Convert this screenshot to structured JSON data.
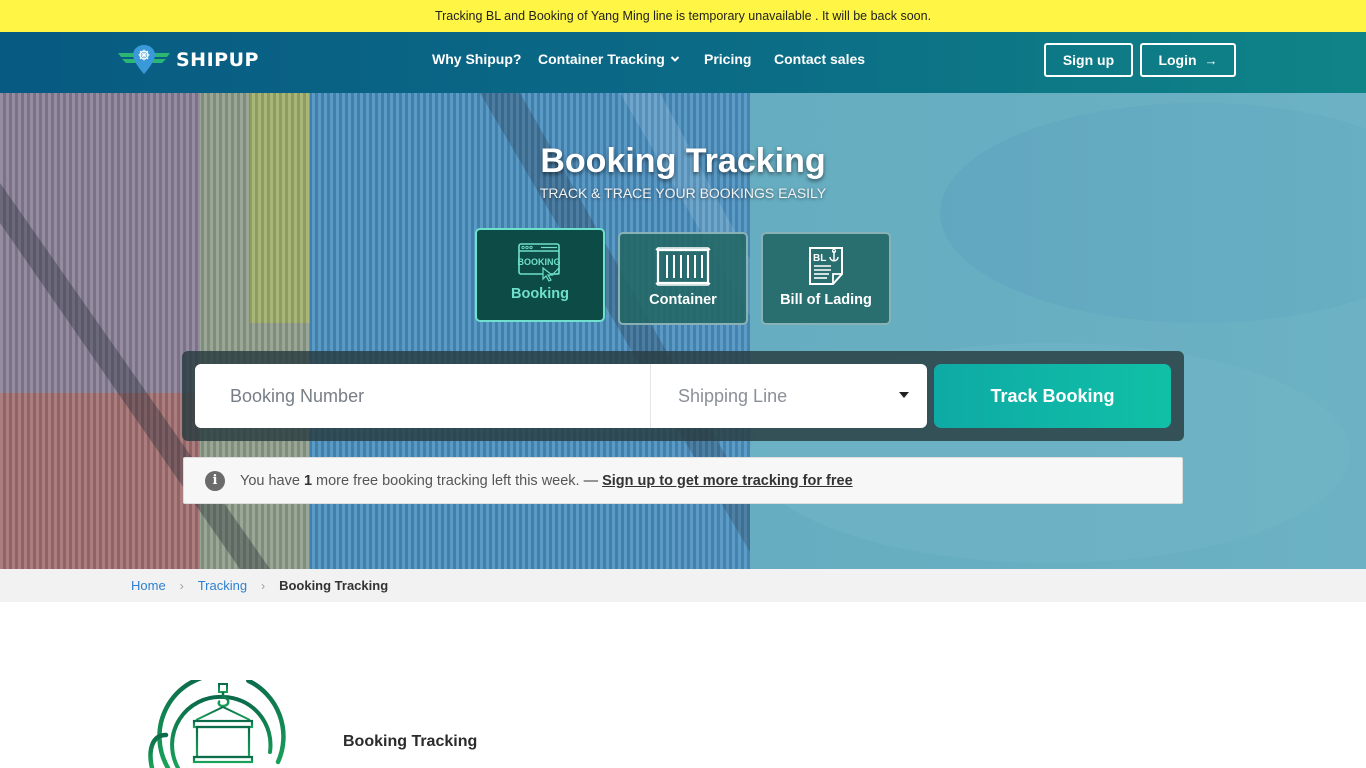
{
  "notice": {
    "text": "Tracking BL and Booking of Yang Ming line is temporary unavailable . It will be back soon."
  },
  "navbar": {
    "logo_text": "SHIPUP",
    "links": [
      {
        "label": "Why Shipup?",
        "icon": null
      },
      {
        "label": "Container Tracking",
        "icon": "chevron-down-icon"
      },
      {
        "label": "Pricing",
        "icon": null
      },
      {
        "label": "Contact sales",
        "icon": null
      }
    ],
    "chevron_glyph": "❯",
    "signup_label": "Sign up",
    "login_label": "Login",
    "login_icon": "→"
  },
  "hero": {
    "title": "Booking Tracking",
    "subtitle": "TRACK & TRACE YOUR BOOKINGS EASILY",
    "tracking_types": [
      {
        "label": "Booking",
        "icon": "booking-icon",
        "active": true
      },
      {
        "label": "Container",
        "icon": "container-icon",
        "active": false
      },
      {
        "label": "Bill of Lading",
        "icon": "bill-of-lading-icon",
        "active": false
      }
    ],
    "search": {
      "booking_placeholder": "Booking Number",
      "booking_value": "",
      "shipping_line_placeholder": "Shipping Line",
      "track_button_label": "Track Booking"
    },
    "info": {
      "icon_glyph": "i",
      "prefix": "You have",
      "count": "1",
      "suffix": "more free booking tracking left this week.",
      "dash": "—",
      "link_text": "Sign up to get more tracking for free"
    }
  },
  "breadcrumb": {
    "items": [
      {
        "label": "Home",
        "link": true
      },
      {
        "label": "Tracking",
        "link": true
      },
      {
        "label": "Booking Tracking",
        "link": false
      }
    ],
    "separator": "›"
  },
  "content": {
    "title": "Booking Tracking"
  },
  "colors": {
    "notice_bg": "#fef545",
    "nav_start": "#075a82",
    "nav_end": "#0f8487",
    "accent_teal": "#10c0a6",
    "active_card_border": "#6fe0cc",
    "link_blue": "#2f80d1",
    "icon_green": "#0e7a4a"
  }
}
